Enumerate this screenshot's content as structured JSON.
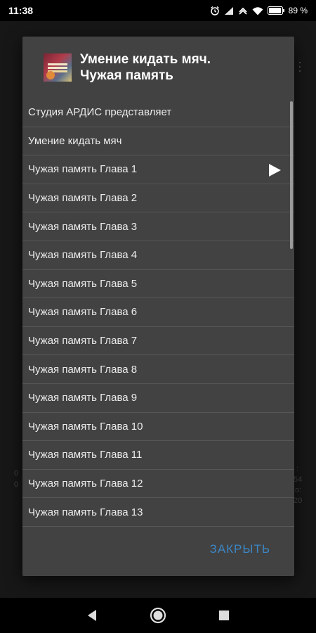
{
  "status_bar": {
    "time": "11:38",
    "battery": "89 %",
    "icons": [
      "alarm-icon",
      "signal-icon",
      "data-saver-icon",
      "wifi-icon",
      "battery-icon"
    ]
  },
  "background_app": {
    "left_fragments": [
      "0",
      "0"
    ],
    "right_fragments": [
      ":",
      "54",
      "o:",
      "20"
    ]
  },
  "dialog": {
    "title_line1": "Умение кидать мяч.",
    "title_line2": "Чужая память",
    "tracks": [
      {
        "label": "Студия АРДИС представляет",
        "playing": false
      },
      {
        "label": "Умение кидать мяч",
        "playing": false
      },
      {
        "label": "Чужая память Глава 1",
        "playing": true
      },
      {
        "label": "Чужая память Глава 2",
        "playing": false
      },
      {
        "label": "Чужая память Глава 3",
        "playing": false
      },
      {
        "label": "Чужая память Глава 4",
        "playing": false
      },
      {
        "label": "Чужая память Глава 5",
        "playing": false
      },
      {
        "label": "Чужая память Глава 6",
        "playing": false
      },
      {
        "label": "Чужая память Глава 7",
        "playing": false
      },
      {
        "label": "Чужая память Глава 8",
        "playing": false
      },
      {
        "label": "Чужая память Глава 9",
        "playing": false
      },
      {
        "label": "Чужая память Глава 10",
        "playing": false
      },
      {
        "label": "Чужая память Глава 11",
        "playing": false
      },
      {
        "label": "Чужая память Глава 12",
        "playing": false
      },
      {
        "label": "Чужая память Глава 13",
        "playing": false
      }
    ],
    "close_label": "ЗАКРЫТЬ",
    "accent_color": "#3b86c4"
  },
  "nav_bar": {
    "buttons": [
      "back-icon",
      "home-icon",
      "recents-icon"
    ]
  }
}
